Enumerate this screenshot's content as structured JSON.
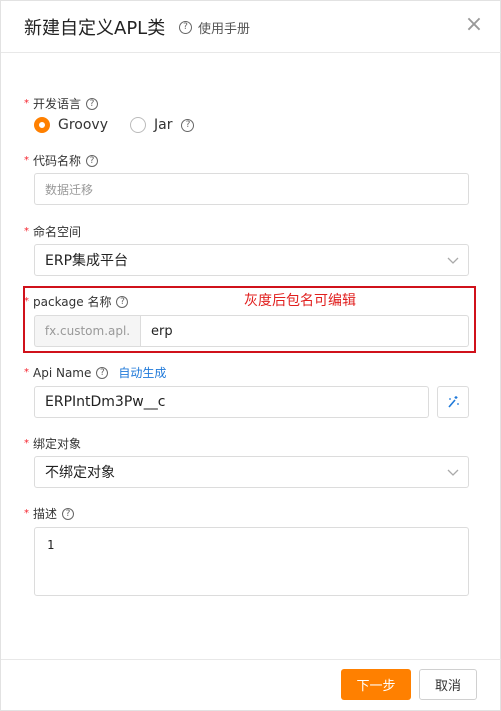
{
  "dialog": {
    "title": "新建自定义APL类",
    "help_label": "使用手册",
    "close_glyph": "×"
  },
  "fields": {
    "language": {
      "label": "开发语言",
      "options": [
        {
          "label": "Groovy",
          "selected": true
        },
        {
          "label": "Jar",
          "selected": false
        }
      ]
    },
    "code_name": {
      "label": "代码名称",
      "placeholder": "数据迁移"
    },
    "namespace": {
      "label": "命名空间",
      "value": "ERP集成平台"
    },
    "package": {
      "label": "package 名称",
      "prefix": "fx.custom.apl.",
      "value": "erp"
    },
    "api_name": {
      "label": "Api Name",
      "auto_link": "自动生成",
      "value": "ERPIntDm3Pw__c"
    },
    "bind_object": {
      "label": "绑定对象",
      "value": "不绑定对象"
    },
    "description": {
      "label": "描述",
      "value": "1"
    }
  },
  "annotation": {
    "text": "灰度后包名可编辑",
    "color": "#d0111b"
  },
  "footer": {
    "next_label": "下一步",
    "cancel_label": "取消"
  },
  "colors": {
    "accent": "#ff8000",
    "link": "#1f79d9",
    "required": "#f5222d"
  }
}
